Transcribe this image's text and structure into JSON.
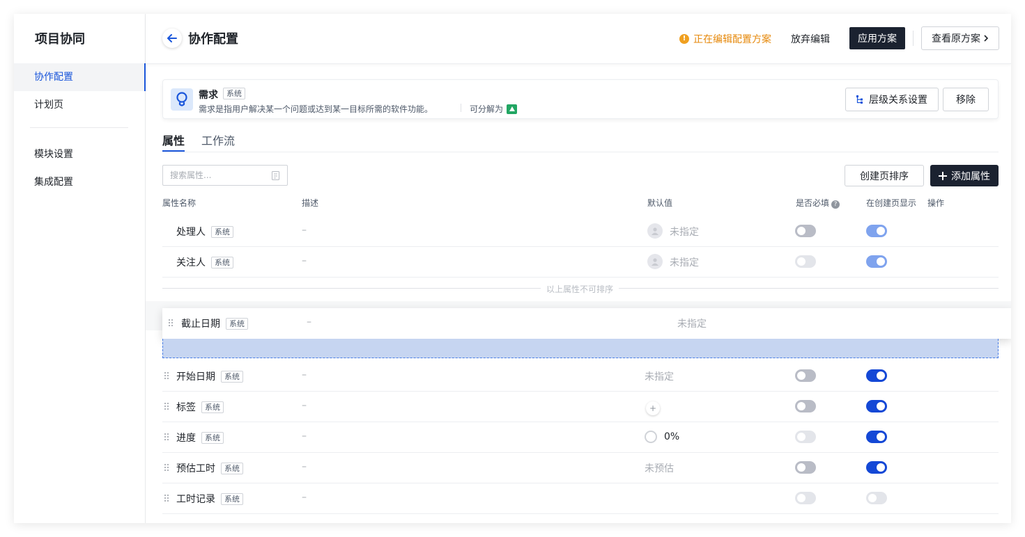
{
  "sidebar": {
    "title": "项目协同",
    "items": [
      {
        "label": "协作配置",
        "active": true
      },
      {
        "label": "计划页",
        "active": false
      },
      {
        "label": "模块设置",
        "active": false
      },
      {
        "label": "集成配置",
        "active": false
      }
    ]
  },
  "header": {
    "title": "协作配置",
    "warning": "正在编辑配置方案",
    "discard_label": "放弃编辑",
    "apply_label": "应用方案",
    "view_original_label": "查看原方案"
  },
  "item_type": {
    "name": "需求",
    "tag": "系统",
    "description": "需求是指用户解决某一个问题或达到某一目标所需的软件功能。",
    "split_label": "可分解为",
    "hierarchy_button": "层级关系设置",
    "remove_button": "移除"
  },
  "tabs": [
    {
      "label": "属性",
      "active": true
    },
    {
      "label": "工作流",
      "active": false
    }
  ],
  "toolbar": {
    "search_placeholder": "搜索属性...",
    "sort_button": "创建页排序",
    "add_button": "添加属性"
  },
  "table": {
    "columns": {
      "name": "属性名称",
      "description": "描述",
      "default": "默认值",
      "required": "是否必填",
      "show_on_create": "在创建页显示",
      "actions": "操作"
    },
    "fixed_rows": [
      {
        "name": "处理人",
        "tag": "系统",
        "description": "–",
        "default": "未指定"
      },
      {
        "name": "关注人",
        "tag": "系统",
        "description": "–",
        "default": "未指定"
      }
    ],
    "sort_note": "以上属性不可排序",
    "dragging_row": {
      "name": "截止日期",
      "tag": "系统",
      "description": "–",
      "default": "未指定"
    },
    "rows": [
      {
        "name": "开始日期",
        "tag": "系统",
        "description": "–",
        "default": "未指定"
      },
      {
        "name": "标签",
        "tag": "系统",
        "description": "–",
        "default": "+"
      },
      {
        "name": "进度",
        "tag": "系统",
        "description": "–",
        "default": "0%"
      },
      {
        "name": "预估工时",
        "tag": "系统",
        "description": "–",
        "default": "未预估"
      },
      {
        "name": "工时记录",
        "tag": "系统",
        "description": "–",
        "default": ""
      }
    ]
  },
  "colors": {
    "accent": "#1a56db",
    "toggle_on": "#1448d6",
    "warning": "#e6890c",
    "dark_button": "#1b2230"
  }
}
